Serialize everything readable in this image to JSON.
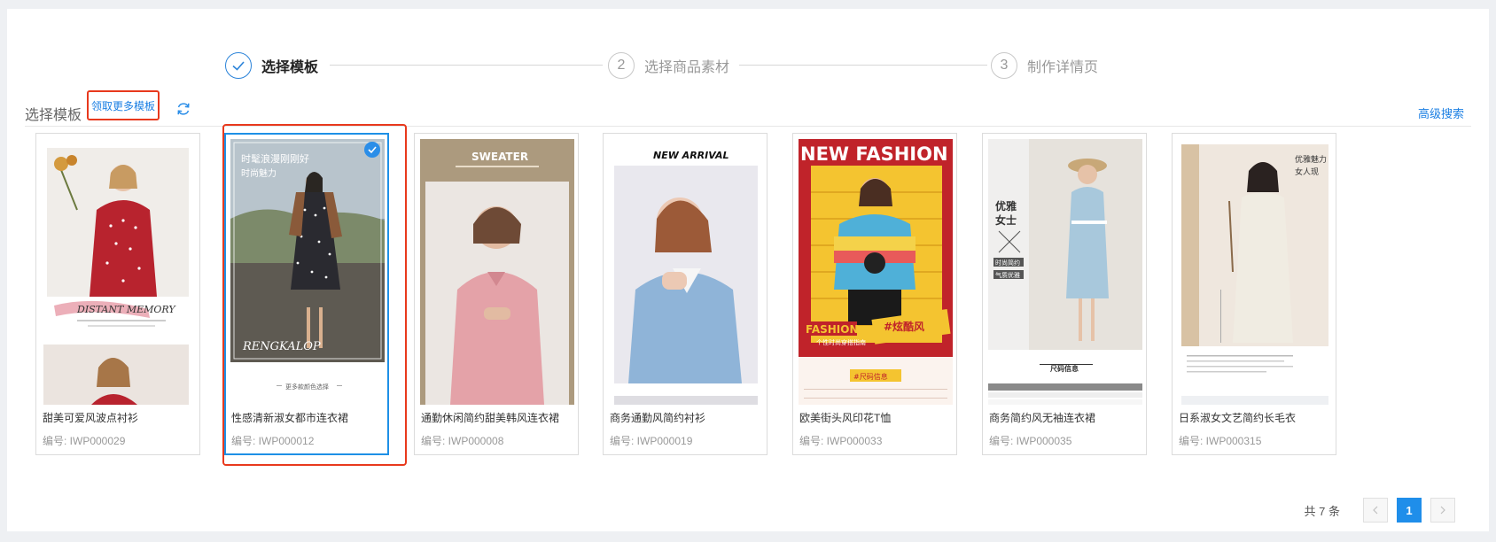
{
  "steps": [
    {
      "number": "",
      "label": "选择模板",
      "state": "done"
    },
    {
      "number": "2",
      "label": "选择商品素材",
      "state": "pending"
    },
    {
      "number": "3",
      "label": "制作详情页",
      "state": "pending"
    }
  ],
  "toolbar": {
    "title": "选择模板",
    "more_templates": "领取更多模板",
    "advanced_search": "高级搜索"
  },
  "thumb_text": {
    "t1_banner": "DISTANT MEMORY",
    "t2_line1": "时髦浪漫刚刚好",
    "t2_line2": "时尚魅力",
    "t2_brand": "RENGKALOP",
    "t2_footer": "更多款颜色选择",
    "t3_title": "SWEATER",
    "t4_title": "NEW ARRIVAL",
    "t5_title": "NEW FASHION",
    "t5_badge1": "FASHION",
    "t5_badge2": "#炫酷风",
    "t5_sub": "个性时尚穿搭指南",
    "t5_size": "#尺码信息",
    "t6_text1": "优雅",
    "t6_text2": "女士",
    "t6_tag1": "时尚简约",
    "t6_tag2": "气质优雅",
    "t6_size": "尺码信息",
    "t7_text1": "优雅魅力",
    "t7_text2": "女人现"
  },
  "cards": [
    {
      "name": "甜美可爱风波点衬衫",
      "code": "编号: IWP000029"
    },
    {
      "name": "性感清新淑女都市连衣裙",
      "code": "编号: IWP000012"
    },
    {
      "name": "通勤休闲简约甜美韩风连衣裙",
      "code": "编号: IWP000008"
    },
    {
      "name": "商务通勤风简约衬衫",
      "code": "编号: IWP000019"
    },
    {
      "name": "欧美街头风印花T恤",
      "code": "编号: IWP000033"
    },
    {
      "name": "商务简约风无袖连衣裙",
      "code": "编号: IWP000035"
    },
    {
      "name": "日系淑女文艺简约长毛衣",
      "code": "编号: IWP000315"
    }
  ],
  "pagination": {
    "total": "共 7 条",
    "current": "1",
    "prev_icon": "chevron-left-icon",
    "next_icon": "chevron-right-icon"
  },
  "colors": {
    "accent": "#1f8eea",
    "highlight": "#e8391d"
  }
}
